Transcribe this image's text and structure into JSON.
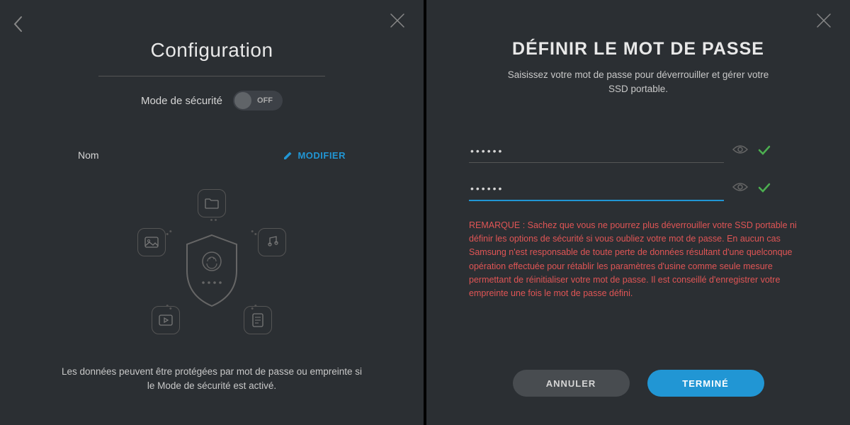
{
  "left": {
    "title": "Configuration",
    "security_label": "Mode de sécurité",
    "toggle_state": "OFF",
    "name_label": "Nom",
    "modify_label": "MODIFIER",
    "footer": "Les données peuvent être protégées par mot de passe ou empreinte si le Mode de sécurité est activé."
  },
  "right": {
    "title": "DÉFINIR LE MOT DE PASSE",
    "subtitle": "Saisissez votre mot de passe pour déverrouiller et gérer votre SSD portable.",
    "password1": "••••••",
    "password2": "••••••",
    "warning": "REMARQUE : Sachez que vous ne pourrez plus déverrouiller votre SSD portable ni définir les options de sécurité si vous oubliez votre mot de passe. En aucun cas Samsung n'est responsable de toute perte de données résultant d'une quelconque opération effectuée pour rétablir les paramètres d'usine comme seule mesure permettant de réinitialiser votre mot de passe. Il est conseillé d'enregistrer votre empreinte une fois le mot de passe défini.",
    "cancel": "ANNULER",
    "done": "TERMINÉ"
  }
}
